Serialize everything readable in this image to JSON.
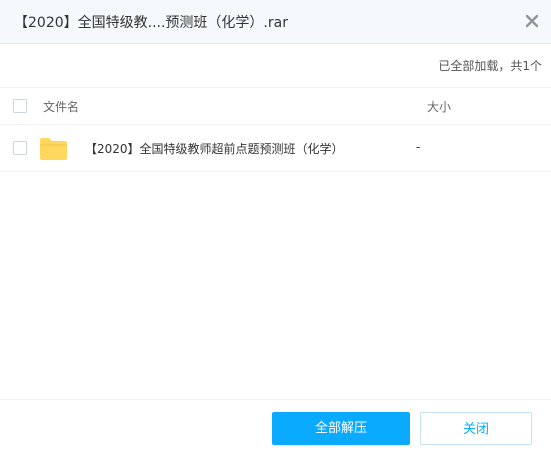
{
  "window": {
    "title": "【2020】全国特级教....预测班（化学）.rar"
  },
  "status_text": "已全部加载，共1个",
  "table": {
    "headers": {
      "name": "文件名",
      "size": "大小"
    },
    "rows": [
      {
        "name": "【2020】全国特级教师超前点题预测班（化学）",
        "size": "-",
        "icon": "folder-icon"
      }
    ]
  },
  "buttons": {
    "extract_all": "全部解压",
    "close": "关闭"
  },
  "colors": {
    "accent": "#09aaff",
    "folder": "#ffd75e",
    "titlebar_bg": "#f5f9fc"
  }
}
